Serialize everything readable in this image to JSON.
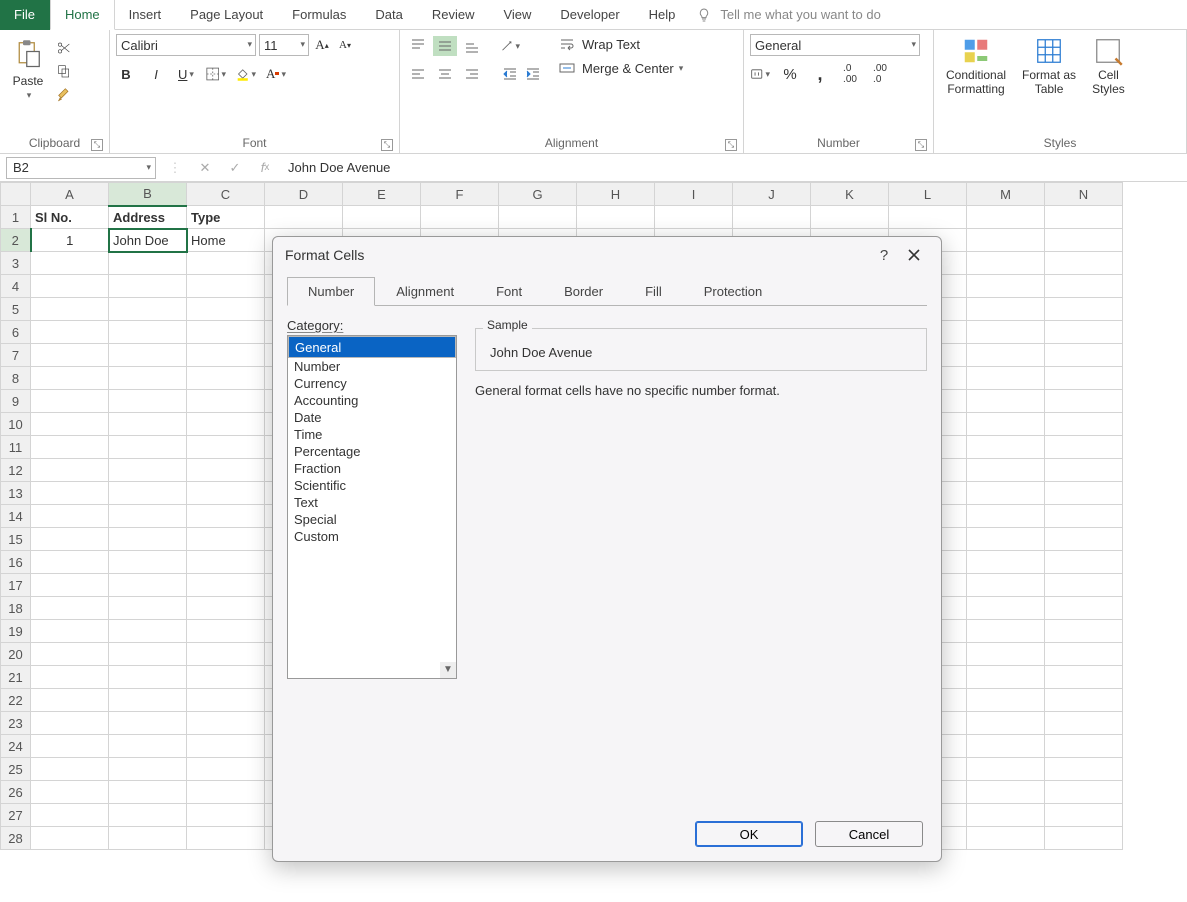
{
  "tabs": {
    "file": "File",
    "home": "Home",
    "insert": "Insert",
    "pagelayout": "Page Layout",
    "formulas": "Formulas",
    "data": "Data",
    "review": "Review",
    "view": "View",
    "developer": "Developer",
    "help": "Help",
    "tell": "Tell me what you want to do"
  },
  "ribbon": {
    "clipboard": {
      "paste": "Paste",
      "label": "Clipboard"
    },
    "font": {
      "name": "Calibri",
      "size": "11",
      "label": "Font"
    },
    "alignment": {
      "wrap": "Wrap Text",
      "merge": "Merge & Center",
      "label": "Alignment"
    },
    "number": {
      "format": "General",
      "label": "Number"
    },
    "styles": {
      "cond": "Conditional\nFormatting",
      "fmt": "Format as\nTable",
      "cell": "Cell\nStyles",
      "label": "Styles"
    }
  },
  "namebox": "B2",
  "formula": "John Doe Avenue",
  "columns": [
    "A",
    "B",
    "C",
    "D",
    "E",
    "F",
    "G",
    "H",
    "I",
    "J",
    "K",
    "L",
    "M",
    "N"
  ],
  "rows": 28,
  "grid": {
    "A1": "Sl No.",
    "B1": "Address",
    "C1": "Type",
    "A2": "1",
    "B2": "John Doe Avenue",
    "C2": "Home"
  },
  "bold_cells": [
    "A1",
    "B1",
    "C1"
  ],
  "selected_cell": "B2",
  "colwidths": {
    "A": 80,
    "B": 80,
    "C": 80,
    "D": 80,
    "E": 80,
    "F": 80,
    "G": 80,
    "H": 80,
    "I": 80,
    "J": 80,
    "K": 80,
    "L": 80,
    "M": 80,
    "N": 80
  },
  "dialog": {
    "title": "Format Cells",
    "tabs": [
      "Number",
      "Alignment",
      "Font",
      "Border",
      "Fill",
      "Protection"
    ],
    "active_tab": "Number",
    "category_label": "Category:",
    "categories": [
      "General",
      "Number",
      "Currency",
      "Accounting",
      "Date",
      "Time",
      "Percentage",
      "Fraction",
      "Scientific",
      "Text",
      "Special",
      "Custom"
    ],
    "selected_category": "General",
    "sample_label": "Sample",
    "sample_value": "John Doe Avenue",
    "description": "General format cells have no specific number format.",
    "ok": "OK",
    "cancel": "Cancel",
    "help": "?"
  }
}
